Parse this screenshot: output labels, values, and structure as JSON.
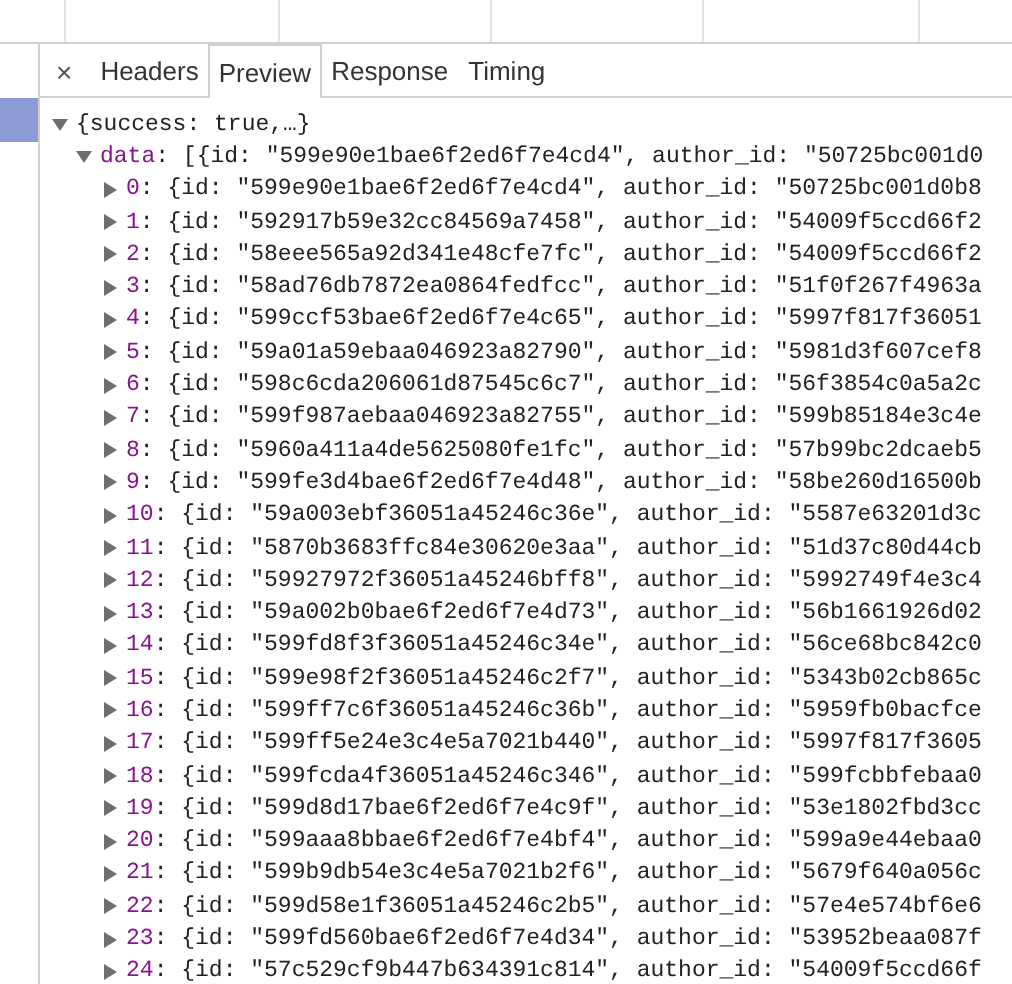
{
  "close_button": "×",
  "tabs": [
    {
      "label": "Headers",
      "selected": false
    },
    {
      "label": "Preview",
      "selected": true
    },
    {
      "label": "Response",
      "selected": false
    },
    {
      "label": "Timing",
      "selected": false
    }
  ],
  "preview": {
    "root": {
      "summary": "{success: true,…}",
      "expanded": true
    },
    "data": {
      "key": "data",
      "summary": ": [{id: \"599e90e1bae6f2ed6f7e4cd4\", author_id: \"50725bc001d0",
      "expanded": true
    },
    "items": [
      {
        "index": "0",
        "text": ": {id: \"599e90e1bae6f2ed6f7e4cd4\", author_id: \"50725bc001d0b8",
        "expanded": false
      },
      {
        "index": "1",
        "text": ": {id: \"592917b59e32cc84569a7458\", author_id: \"54009f5ccd66f2",
        "expanded": false
      },
      {
        "index": "2",
        "text": ": {id: \"58eee565a92d341e48cfe7fc\", author_id: \"54009f5ccd66f2",
        "expanded": false
      },
      {
        "index": "3",
        "text": ": {id: \"58ad76db7872ea0864fedfcc\", author_id: \"51f0f267f4963a",
        "expanded": false
      },
      {
        "index": "4",
        "text": ": {id: \"599ccf53bae6f2ed6f7e4c65\", author_id: \"5997f817f36051",
        "expanded": false
      },
      {
        "index": "5",
        "text": ": {id: \"59a01a59ebaa046923a82790\", author_id: \"5981d3f607cef8",
        "expanded": false
      },
      {
        "index": "6",
        "text": ": {id: \"598c6cda206061d87545c6c7\", author_id: \"56f3854c0a5a2c",
        "expanded": false
      },
      {
        "index": "7",
        "text": ": {id: \"599f987aebaa046923a82755\", author_id: \"599b85184e3c4e",
        "expanded": false
      },
      {
        "index": "8",
        "text": ": {id: \"5960a411a4de5625080fe1fc\", author_id: \"57b99bc2dcaeb5",
        "expanded": false
      },
      {
        "index": "9",
        "text": ": {id: \"599fe3d4bae6f2ed6f7e4d48\", author_id: \"58be260d16500b",
        "expanded": false
      },
      {
        "index": "10",
        "text": ": {id: \"59a003ebf36051a45246c36e\", author_id: \"5587e63201d3c",
        "expanded": false
      },
      {
        "index": "11",
        "text": ": {id: \"5870b3683ffc84e30620e3aa\", author_id: \"51d37c80d44cb",
        "expanded": false
      },
      {
        "index": "12",
        "text": ": {id: \"59927972f36051a45246bff8\", author_id: \"5992749f4e3c4",
        "expanded": false
      },
      {
        "index": "13",
        "text": ": {id: \"59a002b0bae6f2ed6f7e4d73\", author_id: \"56b1661926d02",
        "expanded": false
      },
      {
        "index": "14",
        "text": ": {id: \"599fd8f3f36051a45246c34e\", author_id: \"56ce68bc842c0",
        "expanded": false
      },
      {
        "index": "15",
        "text": ": {id: \"599e98f2f36051a45246c2f7\", author_id: \"5343b02cb865c",
        "expanded": false
      },
      {
        "index": "16",
        "text": ": {id: \"599ff7c6f36051a45246c36b\", author_id: \"5959fb0bacfce",
        "expanded": false
      },
      {
        "index": "17",
        "text": ": {id: \"599ff5e24e3c4e5a7021b440\", author_id: \"5997f817f3605",
        "expanded": false
      },
      {
        "index": "18",
        "text": ": {id: \"599fcda4f36051a45246c346\", author_id: \"599fcbbfebaa0",
        "expanded": false
      },
      {
        "index": "19",
        "text": ": {id: \"599d8d17bae6f2ed6f7e4c9f\", author_id: \"53e1802fbd3cc",
        "expanded": false
      },
      {
        "index": "20",
        "text": ": {id: \"599aaa8bbae6f2ed6f7e4bf4\", author_id: \"599a9e44ebaa0",
        "expanded": false
      },
      {
        "index": "21",
        "text": ": {id: \"599b9db54e3c4e5a7021b2f6\", author_id: \"5679f640a056c",
        "expanded": false
      },
      {
        "index": "22",
        "text": ": {id: \"599d58e1f36051a45246c2b5\", author_id: \"57e4e574bf6e6",
        "expanded": false
      },
      {
        "index": "23",
        "text": ": {id: \"599fd560bae6f2ed6f7e4d34\", author_id: \"53952beaa087f",
        "expanded": false
      },
      {
        "index": "24",
        "text": ": {id: \"57c529cf9b447b634391c814\", author_id: \"54009f5ccd66f",
        "expanded": false
      }
    ]
  }
}
